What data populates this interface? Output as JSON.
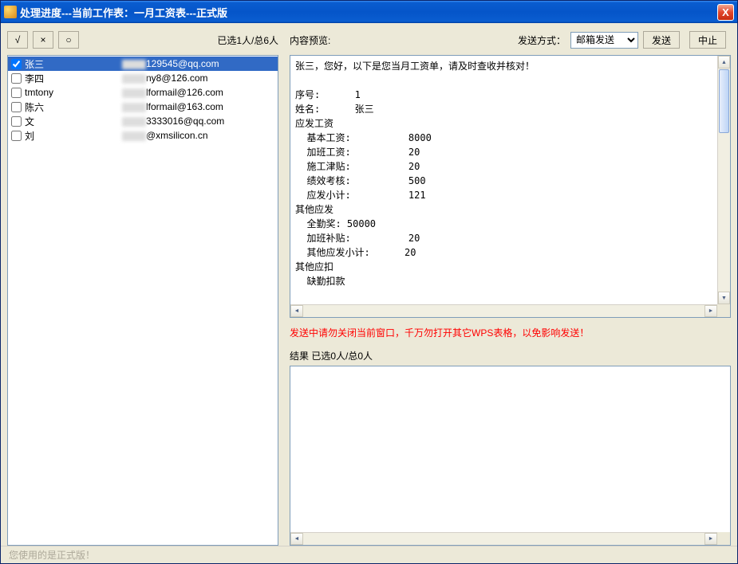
{
  "titlebar": {
    "title": "处理进度---当前工作表：一月工资表---正式版",
    "close_symbol": "X"
  },
  "left": {
    "btn_check_all": "√",
    "btn_uncheck_all": "×",
    "btn_invert": "○",
    "selection_count": "已选1人/总6人",
    "items": [
      {
        "checked": true,
        "selected": true,
        "name": "张三",
        "email_suffix": "129545@qq.com"
      },
      {
        "checked": false,
        "selected": false,
        "name": "李四",
        "email_suffix": "ny8@126.com"
      },
      {
        "checked": false,
        "selected": false,
        "name": "tmtony",
        "email_suffix": "lformail@126.com"
      },
      {
        "checked": false,
        "selected": false,
        "name": "陈六",
        "email_suffix": "lformail@163.com"
      },
      {
        "checked": false,
        "selected": false,
        "name": "文",
        "email_suffix": "3333016@qq.com"
      },
      {
        "checked": false,
        "selected": false,
        "name": "刘",
        "email_suffix": "@xmsilicon.cn"
      }
    ]
  },
  "right": {
    "preview_label": "内容预览:",
    "send_method_label": "发送方式：",
    "send_method_value": "邮箱发送",
    "btn_send": "发送",
    "btn_stop": "中止",
    "preview_text": "张三，您好，以下是您当月工资单，请及时查收并核对！\n\n序号:      1\n姓名:      张三\n应发工资\n  基本工资:          8000\n  加班工资:          20\n  施工津贴:          20\n  绩效考核:          500\n  应发小计:          121\n其他应发\n  全勤奖: 50000\n  加班补贴:          20\n  其他应发小计:      20\n其他应扣\n  缺勤扣款",
    "warning": "发送中请勿关闭当前窗口，千万勿打开其它WPS表格，以免影响发送！",
    "result_label": "结果  已选0人/总0人"
  },
  "statusbar": {
    "text": "您使用的是正式版！"
  }
}
